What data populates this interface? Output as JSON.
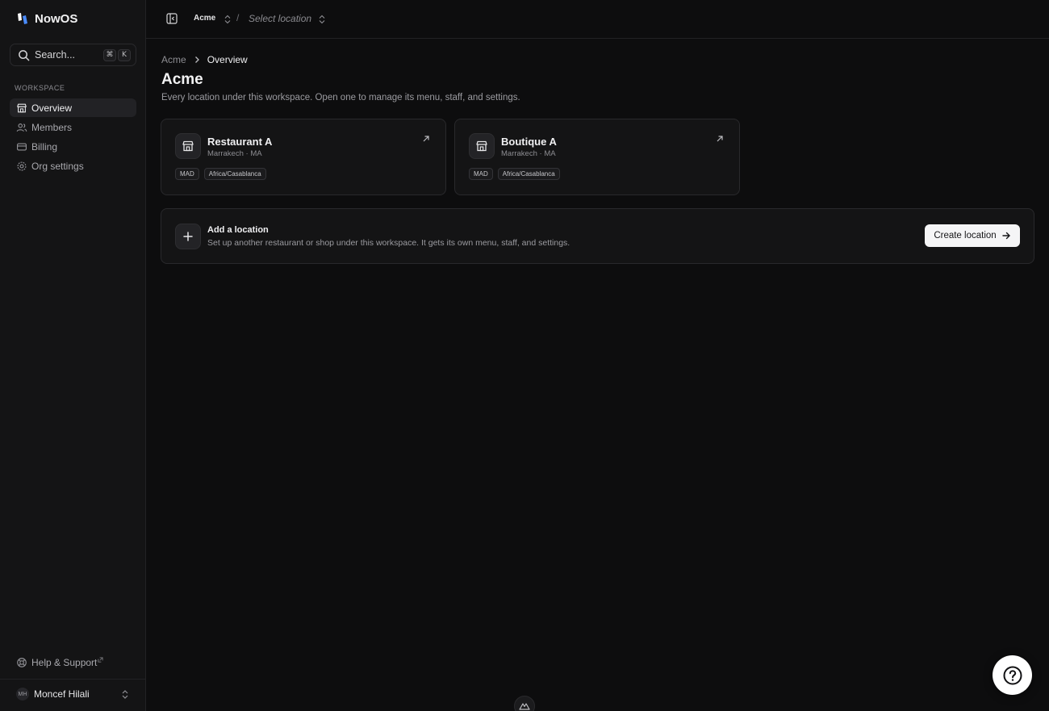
{
  "app": {
    "name": "NowOS"
  },
  "search": {
    "placeholder": "Search...",
    "kbd_mod": "⌘",
    "kbd_key": "K"
  },
  "sidebar": {
    "section_label": "WORKSPACE",
    "items": [
      {
        "label": "Overview",
        "icon": "store-icon",
        "active": true
      },
      {
        "label": "Members",
        "icon": "users-icon",
        "active": false
      },
      {
        "label": "Billing",
        "icon": "credit-card-icon",
        "active": false
      },
      {
        "label": "Org settings",
        "icon": "gear-icon",
        "active": false
      }
    ],
    "help_label": "Help & Support",
    "user": {
      "initials": "MH",
      "name": "Moncef Hilali"
    }
  },
  "topbar": {
    "org": "Acme",
    "separator": "/",
    "location_placeholder": "Select location"
  },
  "breadcrumb": {
    "root": "Acme",
    "current": "Overview"
  },
  "page": {
    "title": "Acme",
    "description": "Every location under this workspace. Open one to manage its menu, staff, and settings."
  },
  "locations": [
    {
      "name": "Restaurant A",
      "address": "Marrakech · MA",
      "currency": "MAD",
      "timezone": "Africa/Casablanca"
    },
    {
      "name": "Boutique A",
      "address": "Marrakech · MA",
      "currency": "MAD",
      "timezone": "Africa/Casablanca"
    }
  ],
  "add_location": {
    "title": "Add a location",
    "description": "Set up another restaurant or shop under this workspace. It gets its own menu, staff, and settings.",
    "button_label": "Create location"
  },
  "colors": {
    "background": "#0d0d0e",
    "sidebar": "#141415",
    "accent_button": "#f5f5f6",
    "brand_blue": "#4a8cff"
  }
}
